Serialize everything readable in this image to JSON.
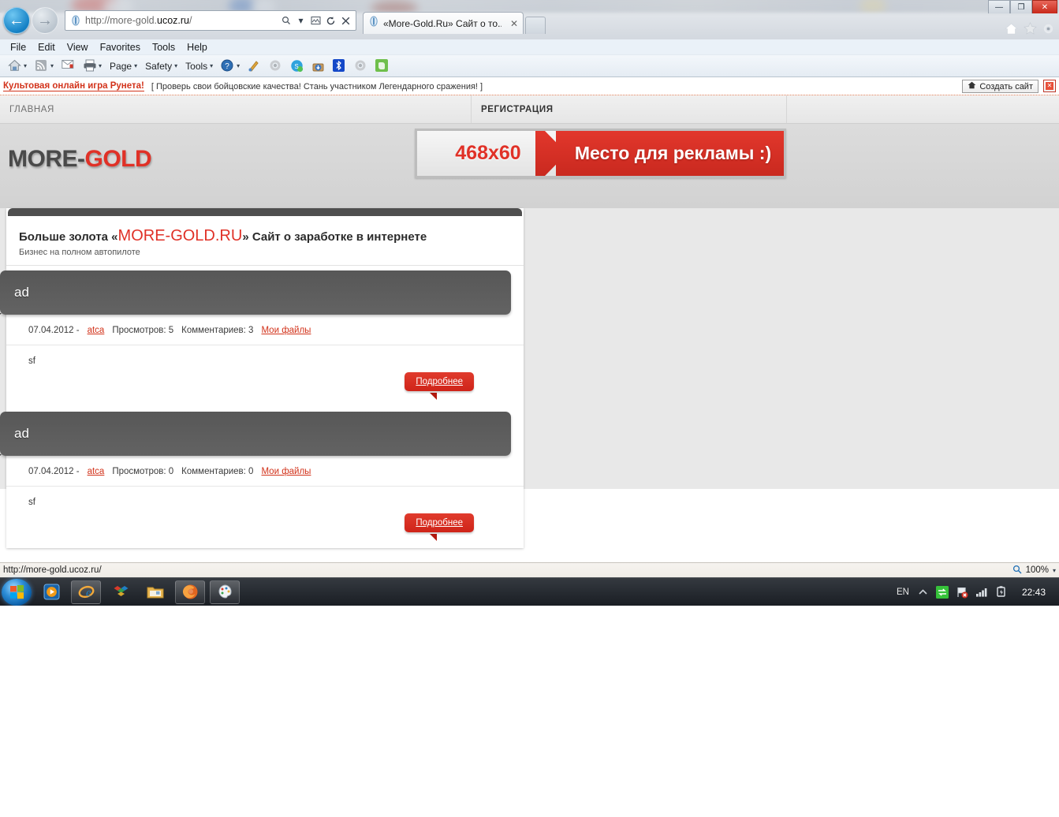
{
  "browser": {
    "window_controls": [
      "minimize",
      "restore",
      "close"
    ],
    "address": {
      "url_prefix": "http://more-gold.",
      "url_domain": "ucoz.ru",
      "url_suffix": "/",
      "full_url": "http://more-gold.ucoz.ru/"
    },
    "address_icons": [
      "search-icon",
      "dropdown-caret",
      "compatibility-view-icon",
      "refresh-icon",
      "stop-icon"
    ],
    "tab": {
      "title": "«More-Gold.Ru» Сайт о то...",
      "close": "✕"
    },
    "menu": [
      "File",
      "Edit",
      "View",
      "Favorites",
      "Tools",
      "Help"
    ],
    "command_bar": [
      {
        "name": "home",
        "label": "",
        "caret": true
      },
      {
        "name": "feeds",
        "label": "",
        "caret": true
      },
      {
        "name": "read-mail",
        "label": "",
        "caret": false
      },
      {
        "name": "print",
        "label": "",
        "caret": true
      },
      {
        "name": "page",
        "label": "Page",
        "caret": true
      },
      {
        "name": "safety",
        "label": "Safety",
        "caret": true
      },
      {
        "name": "tools",
        "label": "Tools",
        "caret": true
      },
      {
        "name": "help",
        "label": "",
        "caret": true
      }
    ],
    "chrome_right_icons": [
      "home-icon",
      "favorites-star-icon",
      "tools-gear-icon"
    ],
    "status": {
      "url": "http://more-gold.ucoz.ru/",
      "zoom": "100%"
    }
  },
  "ucoz_bar": {
    "promo_link": "Культовая онлайн игра Рунета!",
    "promo_text": "[ Проверь свои бойцовские качества! Стань участником Легендарного сражения! ]",
    "create_site_label": "Создать сайт",
    "close_label": "✕"
  },
  "site": {
    "nav": {
      "home": "ГЛАВНАЯ",
      "registration": "РЕГИСТРАЦИЯ"
    },
    "logo": {
      "part1": "MORE-",
      "part2": "GOLD",
      "color1": "#4a4a4a",
      "color2": "#e03127"
    },
    "ad_banner": {
      "size_label": "468x60",
      "text": "Место для рекламы :)",
      "accent": "#d12b20"
    },
    "entry_header": {
      "prefix": "Больше золота «",
      "brand": "MORE-GOLD.RU",
      "suffix": "» Сайт о заработке в интернете",
      "subtitle": "Бизнес на полном автопилоте"
    },
    "posts": [
      {
        "title": "ad",
        "date": "07.04.2012 -",
        "author": "atca",
        "views": "Просмотров: 5",
        "comments": "Комментариев: 3",
        "category": "Мои файлы",
        "body": "sf",
        "more_label": "Подробнее"
      },
      {
        "title": "ad",
        "date": "07.04.2012 -",
        "author": "atca",
        "views": "Просмотров: 0",
        "comments": "Комментариев: 0",
        "category": "Мои файлы",
        "body": "sf",
        "more_label": "Подробнее"
      }
    ]
  },
  "taskbar": {
    "start": "windows-start-orb",
    "items": [
      "media-player-icon",
      "internet-explorer-icon",
      "dropbox-icon",
      "file-explorer-icon",
      "firefox-icon",
      "paint-icon"
    ],
    "tray": {
      "language": "EN",
      "icons": [
        "show-hidden-icon",
        "network-transfer-icon",
        "action-center-flag-icon",
        "signal-bars-icon",
        "battery-plug-icon"
      ],
      "clock": "22:43"
    }
  }
}
